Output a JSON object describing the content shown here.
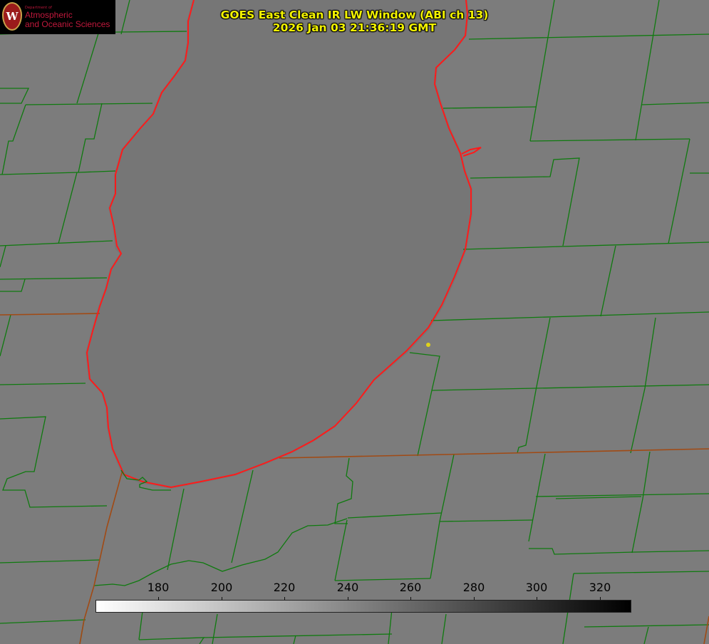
{
  "header": {
    "title_line1": "GOES East Clean IR LW Window (ABI ch 13)",
    "title_line2": "2026 Jan 03 21:36:19 GMT"
  },
  "logo": {
    "seal_letter": "W",
    "department": "Department of",
    "line1": "Atmospheric",
    "line2": "and Oceanic Sciences",
    "color": "#c0183c"
  },
  "colorbar": {
    "min": 160,
    "max": 330,
    "ticks": [
      180,
      200,
      220,
      240,
      260,
      280,
      300,
      320
    ]
  },
  "colors": {
    "background": "#7c7c7c",
    "lake": "#777777",
    "county_lines": "#0f7a0f",
    "state_lines": "#a14a14",
    "shoreline": "#ff1a1a",
    "title": "#f3f300",
    "marker": "#e0d21a"
  }
}
